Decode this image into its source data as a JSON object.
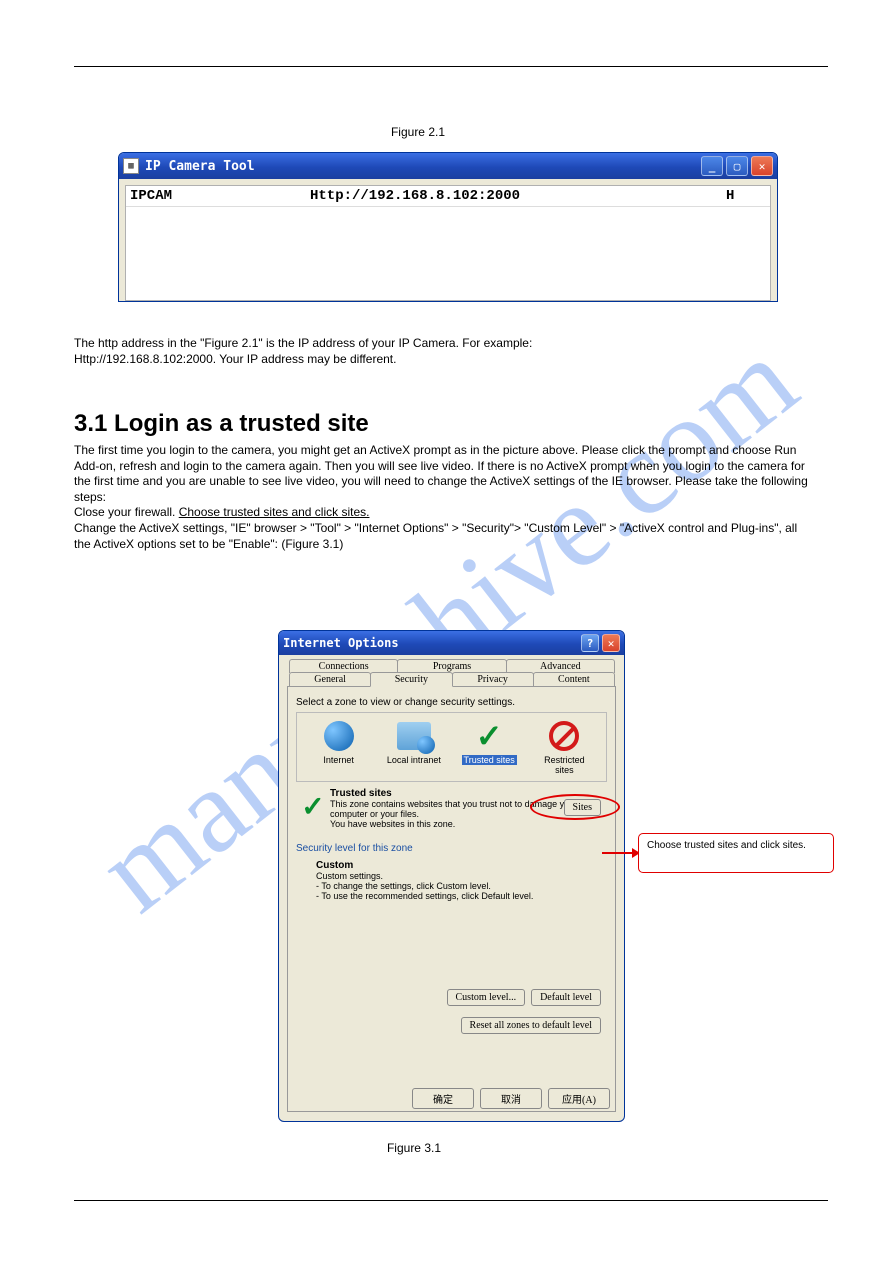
{
  "figure1": "Figure 2.1",
  "figure3_caption": "Figure 3.1",
  "heading": "3.1 Login as a trusted site",
  "para1a": "The http address in the \"Figure 2.1\" is the IP address of your IP Camera. For example:",
  "para1b": "Http://192.168.8.102:2000. Your IP address may be different.",
  "para2": "The first time you login to the camera, you might get an ActiveX prompt as in the picture above. Please click the prompt and choose Run Add-on, refresh and login to the camera again. Then you will see live video.",
  "para3": "If there is no ActiveX prompt when you login to the camera for the first time and you are unable to see live video, you will need to change the ActiveX settings of the IE browser. Please take the following steps:",
  "para4": "Close your firewall.",
  "para5": "Choose trusted sites and click sites.",
  "para6": "Change the ActiveX settings, \"IE\" browser > \"Tool\" > \"Internet Options\" > \"Security\"> \"Custom Level\" > \"ActiveX control and Plug-ins\", all the ActiveX options set to be \"Enable\": (Figure 3.1)",
  "win1": {
    "title": "IP Camera Tool",
    "row": {
      "name": "IPCAM",
      "url": "Http://192.168.8.102:2000",
      "flag": "H"
    }
  },
  "dialog": {
    "title": "Internet Options",
    "tabs_row1": [
      "Connections",
      "Programs",
      "Advanced"
    ],
    "tabs_row2": [
      "General",
      "Security",
      "Privacy",
      "Content"
    ],
    "zone_prompt": "Select a zone to view or change security settings.",
    "zones": {
      "internet": "Internet",
      "intranet": "Local intranet",
      "trusted": "Trusted sites",
      "restricted_l1": "Restricted",
      "restricted_l2": "sites"
    },
    "trusted_title": "Trusted sites",
    "trusted_desc1": "This zone contains websites that you trust not to damage your computer or your files.",
    "trusted_desc2": "You have websites in this zone.",
    "sites_btn": "Sites",
    "sec_level": "Security level for this zone",
    "custom_title": "Custom",
    "custom_l1": "Custom settings.",
    "custom_l2": "- To change the settings, click Custom level.",
    "custom_l3": "- To use the recommended settings, click Default level.",
    "btn_custom": "Custom level...",
    "btn_default": "Default level",
    "btn_reset": "Reset all zones to default level",
    "btn_ok": "确定",
    "btn_cancel": "取消",
    "btn_apply": "应用(A)"
  },
  "callout": "Choose trusted sites and click sites."
}
